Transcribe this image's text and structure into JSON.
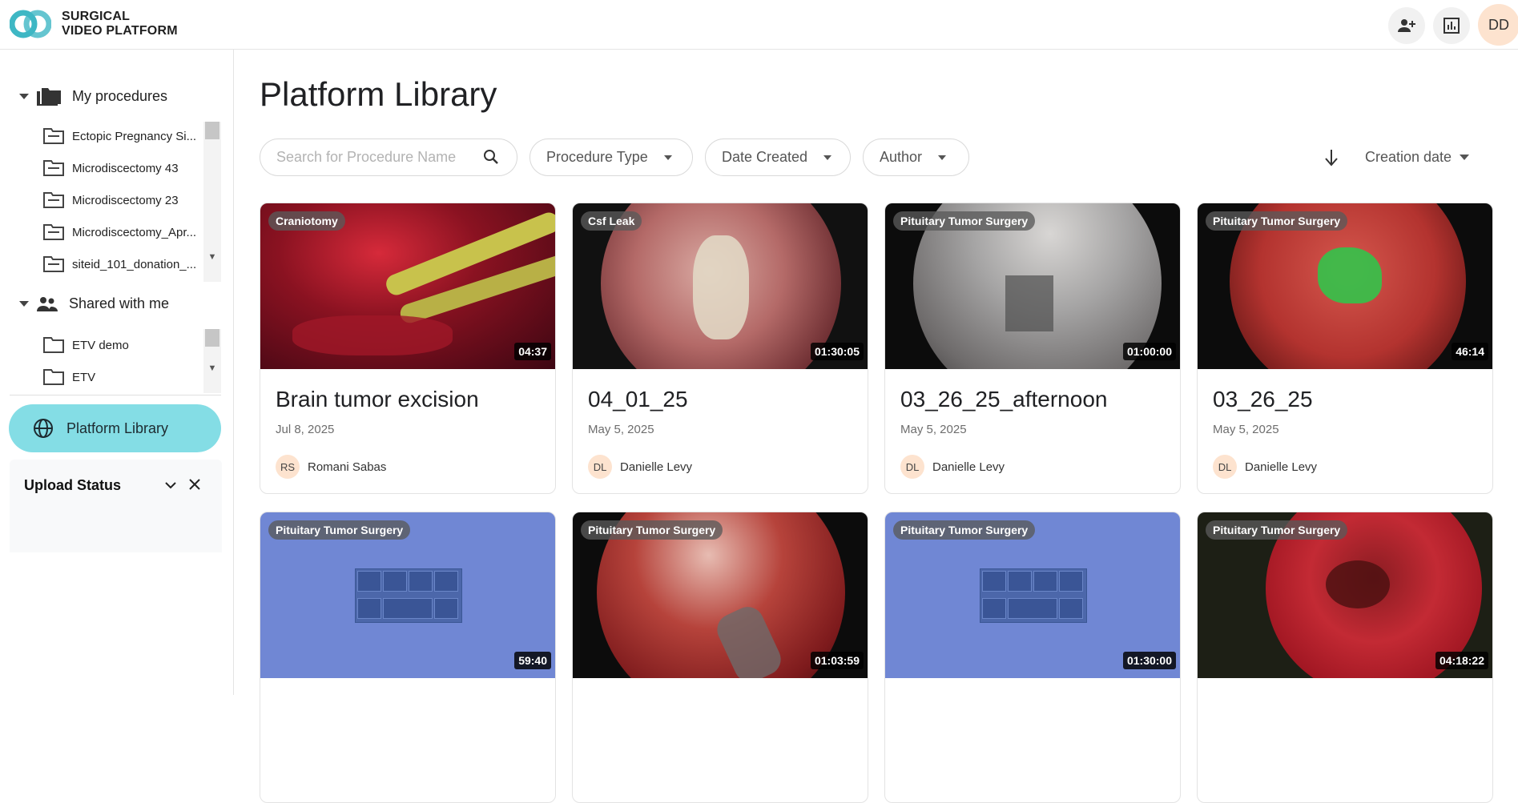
{
  "app": {
    "brand_line1": "SURGICAL",
    "brand_line2": "VIDEO PLATFORM",
    "user_initials": "DD",
    "accent_color": "#84dde5",
    "logo_color": "#3eb7c4"
  },
  "header_icons": [
    "add-user-icon",
    "report-icon"
  ],
  "sidebar": {
    "my_procedures_label": "My procedures",
    "my_procedures": [
      "Ectopic Pregnancy Si...",
      "Microdiscectomy 43",
      "Microdiscectomy 23",
      "Microdiscectomy_Apr...",
      "siteid_101_donation_..."
    ],
    "shared_label": "Shared with me",
    "shared": [
      "ETV demo",
      "ETV"
    ],
    "platform_library_label": "Platform Library",
    "upload_status_label": "Upload Status"
  },
  "main": {
    "title": "Platform Library",
    "search_placeholder": "Search for Procedure Name",
    "filters": {
      "procedure_type": "Procedure Type",
      "date_created": "Date Created",
      "author": "Author"
    },
    "sort_label": "Creation date"
  },
  "cards": [
    {
      "badge": "Craniotomy",
      "duration": "04:37",
      "title": "Brain tumor excision",
      "date": "Jul 8, 2025",
      "author_initials": "RS",
      "author": "Romani Sabas"
    },
    {
      "badge": "Csf Leak",
      "duration": "01:30:05",
      "title": "04_01_25",
      "date": "May 5, 2025",
      "author_initials": "DL",
      "author": "Danielle Levy"
    },
    {
      "badge": "Pituitary Tumor Surgery",
      "duration": "01:00:00",
      "title": "03_26_25_afternoon",
      "date": "May 5, 2025",
      "author_initials": "DL",
      "author": "Danielle Levy"
    },
    {
      "badge": "Pituitary Tumor Surgery",
      "duration": "46:14",
      "title": "03_26_25",
      "date": "May 5, 2025",
      "author_initials": "DL",
      "author": "Danielle Levy"
    },
    {
      "badge": "Pituitary Tumor Surgery",
      "duration": "59:40"
    },
    {
      "badge": "Pituitary Tumor Surgery",
      "duration": "01:03:59"
    },
    {
      "badge": "Pituitary Tumor Surgery",
      "duration": "01:30:00"
    },
    {
      "badge": "Pituitary Tumor Surgery",
      "duration": "04:18:22"
    }
  ]
}
